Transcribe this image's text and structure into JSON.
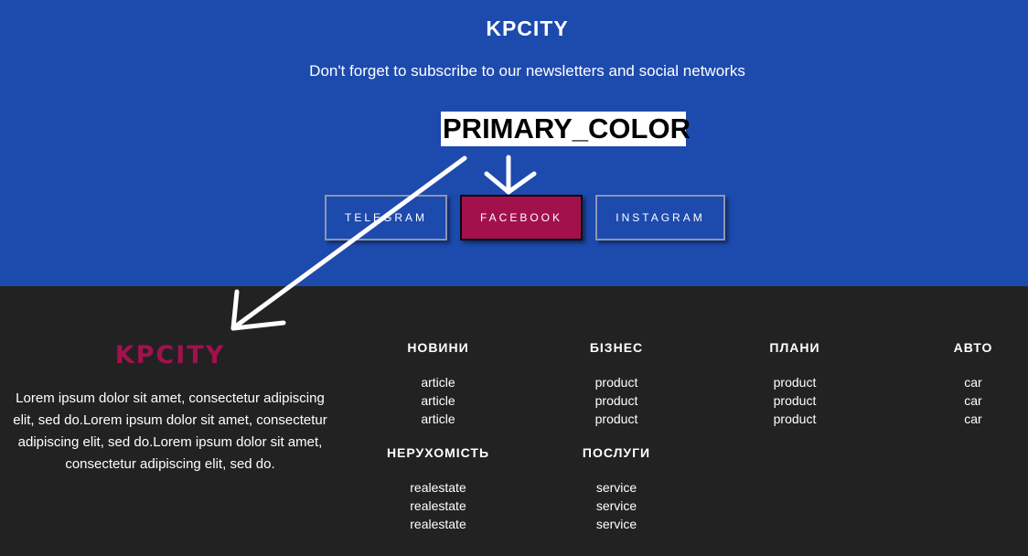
{
  "header": {
    "brand": "KPCITY",
    "tagline": "Don't forget to subscribe to our newsletters and social networks",
    "annotation": "PRIMARY_COLOR",
    "social_buttons": [
      {
        "label": "TELEGRAM"
      },
      {
        "label": "FACEBOOK"
      },
      {
        "label": "INSTAGRAM"
      }
    ]
  },
  "footer": {
    "brand": "KPCITY",
    "description": "Lorem ipsum dolor sit amet, consectetur adipiscing elit, sed do.Lorem ipsum dolor sit amet, consectetur adipiscing elit, sed do.Lorem ipsum dolor sit amet, consectetur adipiscing elit, sed do.",
    "columns": [
      {
        "title": "НОВИНИ",
        "items": [
          "article",
          "article",
          "article"
        ]
      },
      {
        "title": "БІЗНЕС",
        "items": [
          "product",
          "product",
          "product"
        ]
      },
      {
        "title": "ПЛАНИ",
        "items": [
          "product",
          "product",
          "product"
        ]
      },
      {
        "title": "АВТО",
        "items": [
          "car",
          "car",
          "car"
        ]
      },
      {
        "title": "НЕРУХОМІСТЬ",
        "items": [
          "realestate",
          "realestate",
          "realestate"
        ]
      },
      {
        "title": "ПОСЛУГИ",
        "items": [
          "service",
          "service",
          "service"
        ]
      }
    ]
  },
  "colors": {
    "header_bg": "#1d4aad",
    "footer_bg": "#222222",
    "primary": "#a3114d",
    "text": "#ffffff"
  },
  "icons": [
    "arrow-annotation-icon"
  ]
}
